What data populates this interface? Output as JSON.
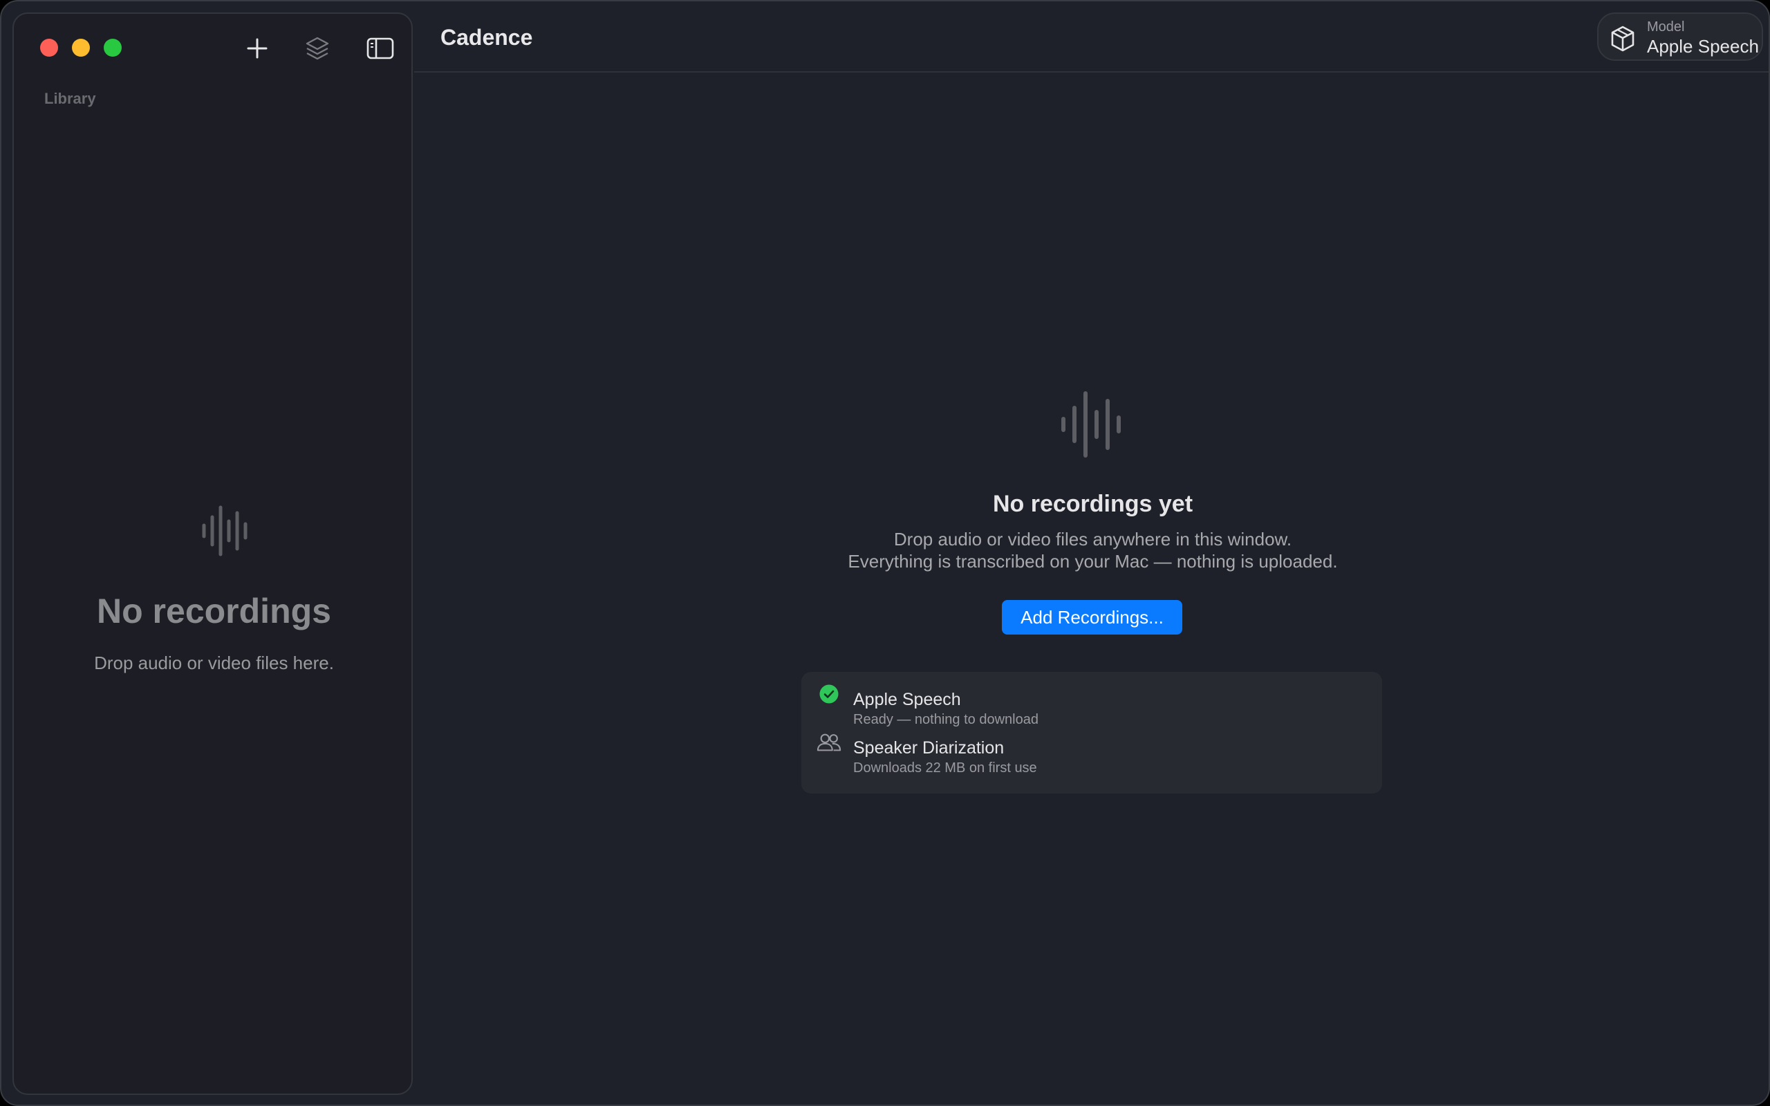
{
  "window": {
    "traffic_lights": [
      {
        "name": "close",
        "color": "#fe5f57"
      },
      {
        "name": "minimize",
        "color": "#febc2e"
      },
      {
        "name": "zoom",
        "color": "#28c840"
      }
    ]
  },
  "sidebar": {
    "tools": [
      {
        "icon": "plus-icon"
      },
      {
        "icon": "layers-icon"
      },
      {
        "icon": "sidebar-toggle-icon"
      }
    ],
    "section_label": "Library",
    "empty": {
      "icon": "waveform-icon",
      "title": "No recordings",
      "subtitle": "Drop audio or video files here."
    }
  },
  "header": {
    "title": "Cadence",
    "model": {
      "icon": "cube-icon",
      "caption": "Model",
      "value": "Apple Speech"
    }
  },
  "main": {
    "empty": {
      "icon": "waveform-icon",
      "title": "No recordings yet",
      "line1": "Drop audio or video files anywhere in this window.",
      "line2": "Everything is transcribed on your Mac — nothing is uploaded.",
      "button": "Add Recordings..."
    },
    "status": [
      {
        "icon": "checkmark-circle-icon",
        "name": "Apple Speech",
        "detail": "Ready — nothing to download",
        "color": "#30c75a"
      },
      {
        "icon": "people-icon",
        "name": "Speaker Diarization",
        "detail": "Downloads 22 MB on first use"
      }
    ]
  },
  "colors": {
    "accent": "#0a7bff",
    "background": "#1f212a",
    "sidebar": "#1d1e25"
  }
}
